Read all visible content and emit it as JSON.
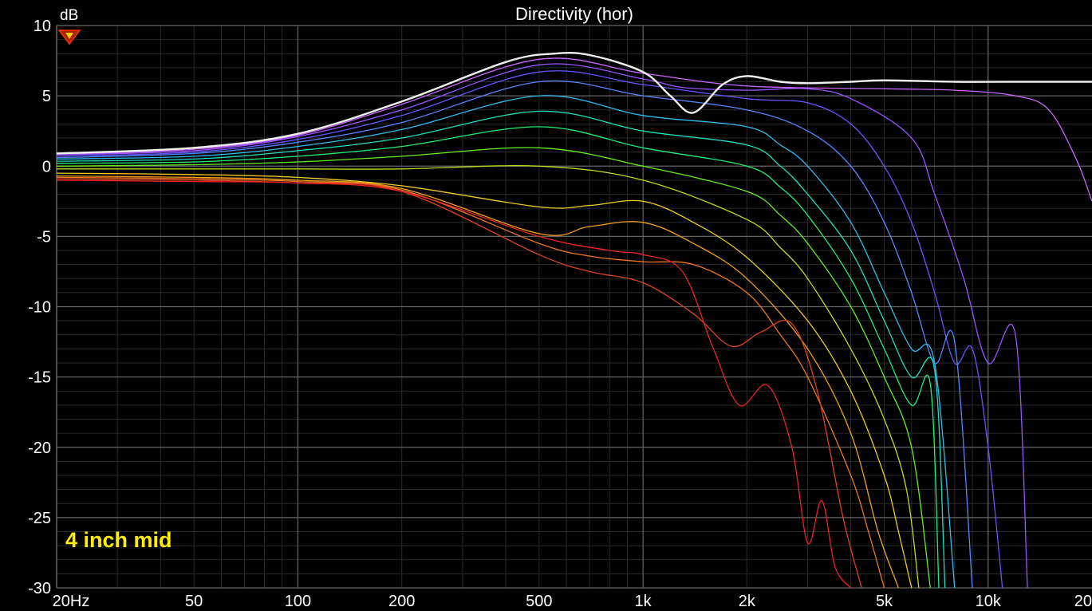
{
  "chart_data": {
    "type": "line",
    "title": "Directivity (hor)",
    "ylabel": "dB",
    "xlabel": "",
    "xscale": "log",
    "xlim": [
      20,
      20000
    ],
    "ylim": [
      -30,
      10
    ],
    "grid": true,
    "x_ticks": [
      {
        "value": 20,
        "label": "20Hz"
      },
      {
        "value": 50,
        "label": "50"
      },
      {
        "value": 100,
        "label": "100"
      },
      {
        "value": 200,
        "label": "200"
      },
      {
        "value": 500,
        "label": "500"
      },
      {
        "value": 1000,
        "label": "1k"
      },
      {
        "value": 2000,
        "label": "2k"
      },
      {
        "value": 5000,
        "label": "5k"
      },
      {
        "value": 10000,
        "label": "10k"
      },
      {
        "value": 20000,
        "label": "20"
      }
    ],
    "y_ticks": [
      {
        "value": 10,
        "label": "10"
      },
      {
        "value": 5,
        "label": "5"
      },
      {
        "value": 0,
        "label": "0"
      },
      {
        "value": -5,
        "label": "-5"
      },
      {
        "value": -10,
        "label": "-10"
      },
      {
        "value": -15,
        "label": "-15"
      },
      {
        "value": -20,
        "label": "-20"
      },
      {
        "value": -25,
        "label": "-25"
      },
      {
        "value": -30,
        "label": "-30"
      }
    ],
    "annotation": "4 inch mid",
    "colors": {
      "background": "#000000",
      "grid_major": "#666666",
      "grid_minor": "#2a2a2a",
      "annotation": "#ffee00",
      "reference": "#ffffff"
    },
    "series": [
      {
        "color": "#f0f0f0",
        "x": [
          20,
          50,
          100,
          200,
          400,
          550,
          700,
          1000,
          1200,
          1400,
          1700,
          2000,
          2500,
          3000,
          4000,
          5000,
          8000,
          12000,
          20000
        ],
        "y": [
          0.9,
          1.3,
          2.3,
          4.6,
          7.4,
          8.0,
          7.9,
          6.7,
          5.0,
          3.8,
          5.8,
          6.4,
          6.0,
          5.9,
          6.0,
          6.1,
          6.0,
          6.0,
          6.0
        ]
      },
      {
        "color": "#cc66ff",
        "x": [
          20,
          50,
          100,
          200,
          500,
          1000,
          2000,
          5000,
          8000,
          12000,
          15000,
          18000,
          20000
        ],
        "y": [
          0.85,
          1.2,
          2.2,
          4.4,
          7.6,
          6.6,
          5.7,
          5.5,
          5.4,
          5.0,
          4.0,
          0.5,
          -2.5
        ]
      },
      {
        "color": "#9955ff",
        "x": [
          20,
          50,
          100,
          200,
          500,
          1000,
          1300,
          2000,
          3000,
          4000,
          6000,
          7000,
          8500,
          10000,
          12000,
          13000
        ],
        "y": [
          0.8,
          1.1,
          2.1,
          4.0,
          7.2,
          6.2,
          5.6,
          5.4,
          5.5,
          4.8,
          2.0,
          -2.0,
          -8.0,
          -14.0,
          -12.0,
          -30.0
        ]
      },
      {
        "color": "#6655ff",
        "x": [
          20,
          50,
          100,
          200,
          500,
          1000,
          2000,
          3000,
          4000,
          5000,
          6000,
          7000,
          8000,
          9000,
          10000,
          11000
        ],
        "y": [
          0.7,
          1.0,
          1.9,
          3.6,
          6.7,
          5.8,
          4.8,
          4.5,
          3.0,
          0.0,
          -4.0,
          -9.0,
          -14.0,
          -13.0,
          -20.0,
          -30.0
        ]
      },
      {
        "color": "#5588ff",
        "x": [
          20,
          50,
          100,
          200,
          500,
          1000,
          2000,
          3000,
          4000,
          5000,
          6000,
          7000,
          8000,
          9000
        ],
        "y": [
          0.6,
          0.9,
          1.7,
          3.1,
          6.0,
          5.0,
          4.0,
          2.5,
          0.0,
          -4.0,
          -9.0,
          -14.0,
          -12.5,
          -30.0
        ]
      },
      {
        "color": "#33bbee",
        "x": [
          20,
          50,
          100,
          200,
          500,
          1000,
          2000,
          2500,
          3000,
          4000,
          5000,
          6000,
          7000,
          8000
        ],
        "y": [
          0.5,
          0.7,
          1.4,
          2.6,
          5.0,
          3.6,
          2.8,
          1.5,
          0.0,
          -4.0,
          -9.0,
          -13.0,
          -14.0,
          -30.0
        ]
      },
      {
        "color": "#22ddbb",
        "x": [
          20,
          50,
          100,
          200,
          500,
          1000,
          2000,
          2500,
          3000,
          4000,
          5000,
          6000,
          7000,
          7500
        ],
        "y": [
          0.35,
          0.5,
          1.1,
          2.0,
          3.9,
          2.5,
          1.5,
          0.0,
          -2.0,
          -6.0,
          -11.0,
          -15.0,
          -14.5,
          -30.0
        ]
      },
      {
        "color": "#22ee77",
        "x": [
          20,
          50,
          100,
          200,
          500,
          1000,
          2000,
          2500,
          3000,
          4000,
          5000,
          6000,
          6800,
          7200
        ],
        "y": [
          0.2,
          0.3,
          0.7,
          1.4,
          2.8,
          1.3,
          0.0,
          -1.5,
          -3.5,
          -8.0,
          -13.0,
          -17.0,
          -15.5,
          -30.0
        ]
      },
      {
        "color": "#66ee22",
        "x": [
          20,
          50,
          100,
          200,
          500,
          1000,
          2000,
          2500,
          3000,
          4000,
          5000,
          6000,
          6800
        ],
        "y": [
          0.0,
          0.1,
          0.3,
          0.7,
          1.3,
          0.0,
          -1.8,
          -3.5,
          -5.5,
          -10.0,
          -15.0,
          -20.0,
          -30.0
        ]
      },
      {
        "color": "#bbdd22",
        "x": [
          20,
          50,
          100,
          200,
          500,
          1000,
          2000,
          2500,
          3000,
          4000,
          5000,
          5800,
          6300
        ],
        "y": [
          -0.2,
          -0.2,
          -0.2,
          -0.2,
          0.0,
          -1.0,
          -3.8,
          -5.8,
          -8.0,
          -13.0,
          -18.0,
          -23.0,
          -30.0
        ]
      },
      {
        "color": "#eecc22",
        "x": [
          20,
          50,
          100,
          200,
          500,
          700,
          1000,
          1400,
          2000,
          3000,
          4000,
          5000,
          5500,
          6000
        ],
        "y": [
          -0.5,
          -0.6,
          -0.8,
          -1.4,
          -2.9,
          -2.8,
          -2.5,
          -4.0,
          -6.5,
          -11.0,
          -16.0,
          -22.0,
          -26.0,
          -30.0
        ]
      },
      {
        "color": "#f0a020",
        "x": [
          20,
          50,
          100,
          200,
          500,
          700,
          1000,
          1400,
          2000,
          3000,
          4000,
          4800,
          5500
        ],
        "y": [
          -0.7,
          -0.8,
          -1.0,
          -1.6,
          -4.8,
          -4.3,
          -4.0,
          -5.5,
          -8.0,
          -13.0,
          -19.0,
          -26.0,
          -30.0
        ]
      },
      {
        "color": "#ee7722",
        "x": [
          20,
          50,
          100,
          200,
          500,
          700,
          1000,
          1400,
          2000,
          2500,
          3000,
          4000,
          4500,
          5000
        ],
        "y": [
          -0.8,
          -0.9,
          -1.1,
          -1.7,
          -5.5,
          -6.4,
          -6.8,
          -7.0,
          -9.0,
          -12.0,
          -15.0,
          -22.0,
          -26.0,
          -30.0
        ]
      },
      {
        "color": "#dd4422",
        "x": [
          20,
          50,
          100,
          200,
          500,
          700,
          1000,
          1400,
          1800,
          2200,
          2700,
          3200,
          3800,
          4300
        ],
        "y": [
          -0.9,
          -1.0,
          -1.2,
          -1.8,
          -6.3,
          -7.5,
          -8.3,
          -10.5,
          -12.8,
          -11.8,
          -11.2,
          -16.0,
          -25.0,
          -30.0
        ]
      },
      {
        "color": "#ee2222",
        "x": [
          20,
          50,
          100,
          200,
          500,
          800,
          1000,
          1300,
          1600,
          1900,
          2300,
          2700,
          3000,
          3300,
          3600,
          4000
        ],
        "y": [
          -1.0,
          -1.1,
          -1.2,
          -1.8,
          -5.0,
          -6.0,
          -6.3,
          -7.5,
          -13.0,
          -17.0,
          -15.6,
          -20.0,
          -26.8,
          -23.8,
          -28.5,
          -30.0
        ]
      }
    ]
  }
}
